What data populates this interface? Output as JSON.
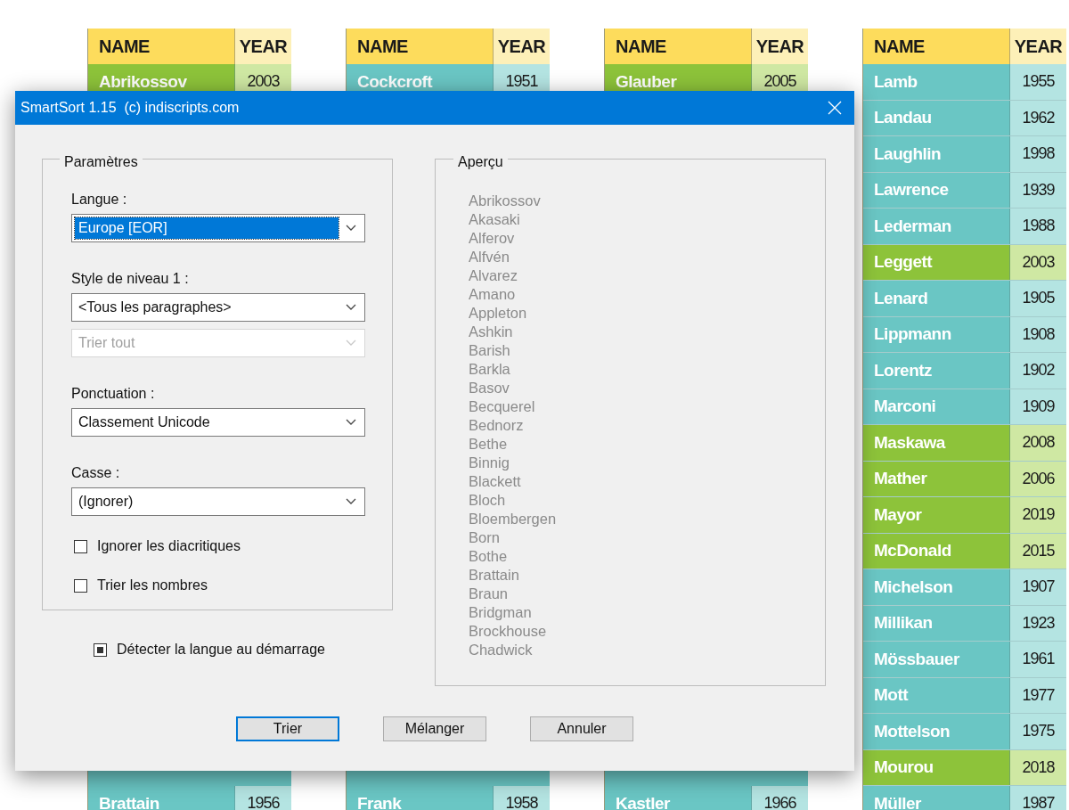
{
  "tables": [
    {
      "columns": [
        "NAME",
        "YEAR"
      ],
      "rows_top": [
        {
          "name": "Abrikossov",
          "year": "2003",
          "highlighted": true
        }
      ],
      "rows_bottom": [
        {
          "name": "Brattain",
          "year": "1956",
          "highlighted": false
        }
      ]
    },
    {
      "columns": [
        "NAME",
        "YEAR"
      ],
      "rows_top": [
        {
          "name": "Cockcroft",
          "year": "1951",
          "highlighted": false
        }
      ],
      "rows_bottom": [
        {
          "name": "Frank",
          "year": "1958",
          "highlighted": false
        }
      ]
    },
    {
      "columns": [
        "NAME",
        "YEAR"
      ],
      "rows_top": [
        {
          "name": "Glauber",
          "year": "2005",
          "highlighted": true
        }
      ],
      "rows_bottom": [
        {
          "name": "Kastler",
          "year": "1966",
          "highlighted": false
        }
      ]
    },
    {
      "columns": [
        "NAME",
        "YEAR"
      ],
      "rows_top": [
        {
          "name": "Lamb",
          "year": "1955",
          "highlighted": false
        },
        {
          "name": "Landau",
          "year": "1962",
          "highlighted": false
        },
        {
          "name": "Laughlin",
          "year": "1998",
          "highlighted": false
        },
        {
          "name": "Lawrence",
          "year": "1939",
          "highlighted": false
        },
        {
          "name": "Lederman",
          "year": "1988",
          "highlighted": false
        },
        {
          "name": "Leggett",
          "year": "2003",
          "highlighted": true
        },
        {
          "name": "Lenard",
          "year": "1905",
          "highlighted": false
        },
        {
          "name": "Lippmann",
          "year": "1908",
          "highlighted": false
        },
        {
          "name": "Lorentz",
          "year": "1902",
          "highlighted": false
        },
        {
          "name": "Marconi",
          "year": "1909",
          "highlighted": false
        },
        {
          "name": "Maskawa",
          "year": "2008",
          "highlighted": true
        },
        {
          "name": "Mather",
          "year": "2006",
          "highlighted": true
        },
        {
          "name": "Mayor",
          "year": "2019",
          "highlighted": true
        },
        {
          "name": "McDonald",
          "year": "2015",
          "highlighted": true
        },
        {
          "name": "Michelson",
          "year": "1907",
          "highlighted": false
        },
        {
          "name": "Millikan",
          "year": "1923",
          "highlighted": false
        },
        {
          "name": "Mössbauer",
          "year": "1961",
          "highlighted": false
        },
        {
          "name": "Mott",
          "year": "1977",
          "highlighted": false
        },
        {
          "name": "Mottelson",
          "year": "1975",
          "highlighted": false
        },
        {
          "name": "Mourou",
          "year": "2018",
          "highlighted": true
        },
        {
          "name": "Müller",
          "year": "1987",
          "highlighted": false
        }
      ]
    }
  ],
  "dialog": {
    "title": "SmartSort 1.15  (c) indiscripts.com",
    "parameters": {
      "legend": "Paramètres",
      "fields": [
        {
          "label": "Langue :",
          "value": "Europe [EOR]",
          "focused": true,
          "disabled": false
        },
        {
          "label": "Style de niveau 1 :",
          "value": "<Tous les paragraphes>",
          "focused": false,
          "disabled": false
        },
        {
          "value": "Trier tout",
          "focused": false,
          "disabled": true
        },
        {
          "label": "Ponctuation :",
          "value": "Classement Unicode",
          "focused": false,
          "disabled": false
        },
        {
          "label": "Casse :",
          "value": "(Ignorer)",
          "focused": false,
          "disabled": false
        }
      ],
      "checkboxes": [
        {
          "label": "Ignorer les diacritiques",
          "checked": false
        },
        {
          "label": "Trier les nombres",
          "checked": false
        }
      ]
    },
    "detect": {
      "label": "Détecter la langue au démarrage",
      "checked": true
    },
    "preview": {
      "legend": "Aperçu",
      "items": [
        "Abrikossov",
        "Akasaki",
        "Alferov",
        "Alfvén",
        "Alvarez",
        "Amano",
        "Appleton",
        "Ashkin",
        "Barish",
        "Barkla",
        "Basov",
        "Becquerel",
        "Bednorz",
        "Bethe",
        "Binnig",
        "Blackett",
        "Bloch",
        "Bloembergen",
        "Born",
        "Bothe",
        "Brattain",
        "Braun",
        "Bridgman",
        "Brockhouse",
        "Chadwick"
      ]
    },
    "buttons": [
      {
        "label": "Trier",
        "default": true
      },
      {
        "label": "Mélanger",
        "default": false
      },
      {
        "label": "Annuler",
        "default": false
      }
    ]
  }
}
